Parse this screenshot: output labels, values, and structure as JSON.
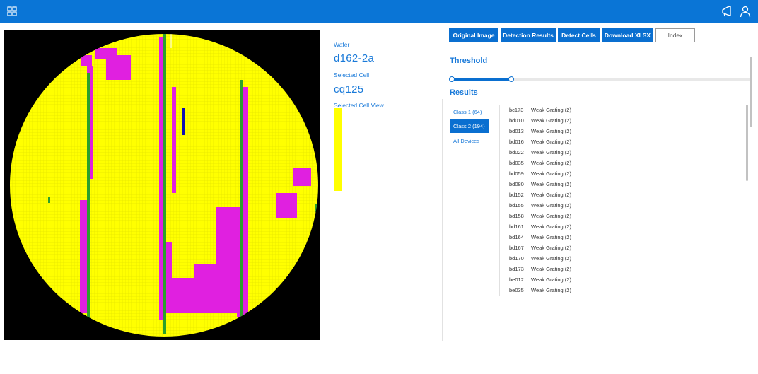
{
  "app": {
    "title": ""
  },
  "titlebar": {
    "apps_icon": "apps-grid-icon",
    "announce_icon": "megaphone-icon",
    "user_icon": "user-icon"
  },
  "colors": {
    "accent": "#0a75d6",
    "button": "#0a6fd0",
    "wafer_fill": "#ffff00",
    "defect_magenta": "#e020e0",
    "defect_green": "#2ca02c",
    "defect_blue": "#1010b0"
  },
  "info": {
    "wafer_label": "Wafer",
    "wafer_value": "d162-2a",
    "cell_label": "Selected Cell",
    "cell_value": "cq125",
    "view_label": "Selected Cell View"
  },
  "toolbar": {
    "buttons": [
      "Original Image",
      "Detection Results",
      "Detect Cells",
      "Download XLSX",
      "Index"
    ]
  },
  "threshold": {
    "title": "Threshold",
    "low": 0.0,
    "high": 0.2
  },
  "results": {
    "title": "Results",
    "classes": [
      "Class 1 (64)",
      "Class 2 (194)",
      "All Devices"
    ],
    "active_class": "Class 2 (194)",
    "rows": [
      {
        "id": "bc173",
        "cls": "Weak Grating (2)"
      },
      {
        "id": "bd010",
        "cls": "Weak Grating (2)"
      },
      {
        "id": "bd013",
        "cls": "Weak Grating (2)"
      },
      {
        "id": "bd016",
        "cls": "Weak Grating (2)"
      },
      {
        "id": "bd022",
        "cls": "Weak Grating (2)"
      },
      {
        "id": "bd035",
        "cls": "Weak Grating (2)"
      },
      {
        "id": "bd059",
        "cls": "Weak Grating (2)"
      },
      {
        "id": "bd080",
        "cls": "Weak Grating (2)"
      },
      {
        "id": "bd152",
        "cls": "Weak Grating (2)"
      },
      {
        "id": "bd155",
        "cls": "Weak Grating (2)"
      },
      {
        "id": "bd158",
        "cls": "Weak Grating (2)"
      },
      {
        "id": "bd161",
        "cls": "Weak Grating (2)"
      },
      {
        "id": "bd164",
        "cls": "Weak Grating (2)"
      },
      {
        "id": "bd167",
        "cls": "Weak Grating (2)"
      },
      {
        "id": "bd170",
        "cls": "Weak Grating (2)"
      },
      {
        "id": "bd173",
        "cls": "Weak Grating (2)"
      },
      {
        "id": "be012",
        "cls": "Weak Grating (2)"
      },
      {
        "id": "be035",
        "cls": "Weak Grating (2)"
      }
    ]
  }
}
